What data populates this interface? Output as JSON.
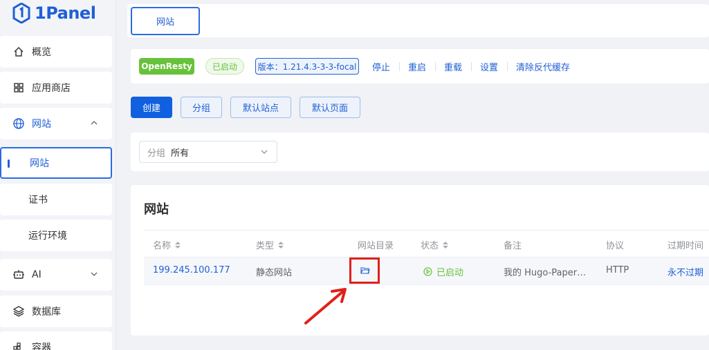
{
  "app": {
    "logo_text": "1Panel"
  },
  "sidebar": {
    "items": [
      {
        "label": "概览",
        "icon": "home-icon"
      },
      {
        "label": "应用商店",
        "icon": "grid-icon"
      },
      {
        "label": "网站",
        "icon": "globe-icon",
        "expanded": true
      },
      {
        "label": "网站",
        "active": true
      },
      {
        "label": "证书"
      },
      {
        "label": "运行环境"
      },
      {
        "label": "AI",
        "icon": "robot-icon"
      },
      {
        "label": "数据库",
        "icon": "layers-icon"
      },
      {
        "label": "容器",
        "icon": "container-icon"
      }
    ]
  },
  "tabs": [
    {
      "label": "网站",
      "active": true
    }
  ],
  "status_bar": {
    "app_name": "OpenResty",
    "state": "已启动",
    "version": "版本：1.21.4.3-3-3-focal",
    "actions": [
      "停止",
      "重启",
      "重载",
      "设置",
      "清除反代缓存"
    ]
  },
  "toolbar": {
    "create_label": "创建",
    "group_label": "分组",
    "default_site_label": "默认站点",
    "default_page_label": "默认页面"
  },
  "filter": {
    "label": "分组",
    "value": "所有"
  },
  "table": {
    "title": "网站",
    "columns": [
      "名称",
      "类型",
      "网站目录",
      "状态",
      "备注",
      "协议",
      "过期时间"
    ],
    "rows": [
      {
        "name": "199.245.100.177",
        "type": "静态网站",
        "status": "已启动",
        "remark": "我的 Hugo-Paper…",
        "protocol": "HTTP",
        "expire": "永不过期"
      }
    ]
  },
  "colors": {
    "accent": "#1f5fd6",
    "success": "#67c23a",
    "annotation": "#e0201a"
  }
}
